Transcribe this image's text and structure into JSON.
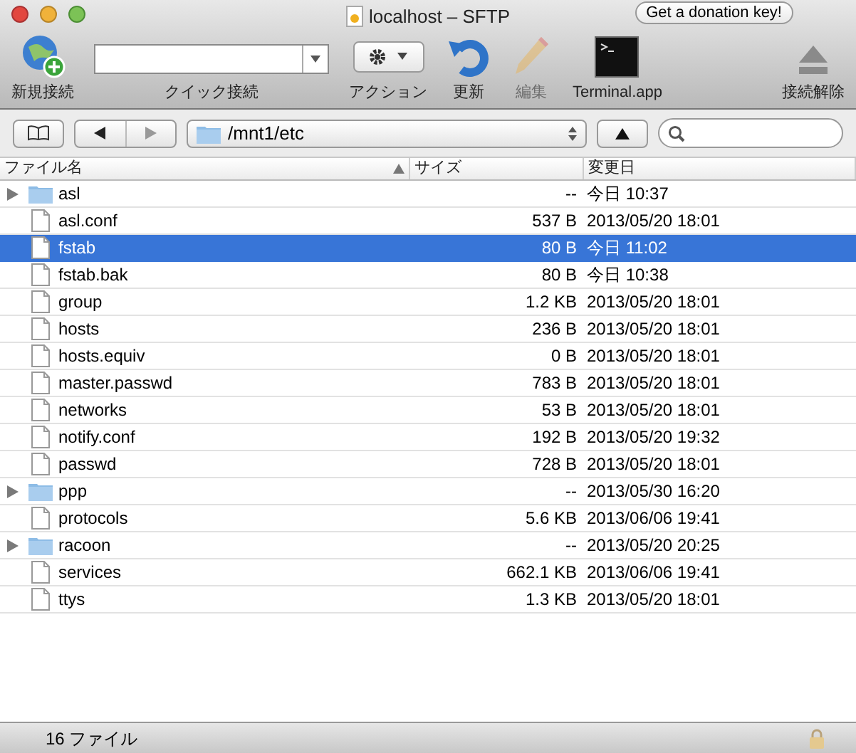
{
  "window": {
    "title": "localhost – SFTP",
    "donation_button": "Get a donation key!"
  },
  "toolbar": [
    {
      "kind": "new",
      "label": "新規接続",
      "disabled": false
    },
    {
      "kind": "quick",
      "label": "クイック接続",
      "disabled": false
    },
    {
      "kind": "action",
      "label": "アクション",
      "disabled": false
    },
    {
      "kind": "refresh",
      "label": "更新",
      "disabled": false
    },
    {
      "kind": "edit",
      "label": "編集",
      "disabled": true
    },
    {
      "kind": "terminal",
      "label": "Terminal.app",
      "disabled": false
    },
    {
      "kind": "disconnect",
      "label": "接続解除",
      "disabled": false
    }
  ],
  "path_bar": {
    "path": "/mnt1/etc"
  },
  "table": {
    "columns": [
      {
        "label": "ファイル名",
        "sorted": true
      },
      {
        "label": "サイズ",
        "sorted": false
      },
      {
        "label": "変更日",
        "sorted": false
      }
    ],
    "rows": [
      {
        "kind": "folder",
        "name": "asl",
        "size": "--",
        "modified": "今日 10:37",
        "selected": false
      },
      {
        "kind": "file",
        "name": "asl.conf",
        "size": "537 B",
        "modified": "2013/05/20 18:01",
        "selected": false
      },
      {
        "kind": "file",
        "name": "fstab",
        "size": "80 B",
        "modified": "今日 11:02",
        "selected": true
      },
      {
        "kind": "file",
        "name": "fstab.bak",
        "size": "80 B",
        "modified": "今日 10:38",
        "selected": false
      },
      {
        "kind": "file",
        "name": "group",
        "size": "1.2 KB",
        "modified": "2013/05/20 18:01",
        "selected": false
      },
      {
        "kind": "file",
        "name": "hosts",
        "size": "236 B",
        "modified": "2013/05/20 18:01",
        "selected": false
      },
      {
        "kind": "file",
        "name": "hosts.equiv",
        "size": "0 B",
        "modified": "2013/05/20 18:01",
        "selected": false
      },
      {
        "kind": "file",
        "name": "master.passwd",
        "size": "783 B",
        "modified": "2013/05/20 18:01",
        "selected": false
      },
      {
        "kind": "file",
        "name": "networks",
        "size": "53 B",
        "modified": "2013/05/20 18:01",
        "selected": false
      },
      {
        "kind": "file",
        "name": "notify.conf",
        "size": "192 B",
        "modified": "2013/05/20 19:32",
        "selected": false
      },
      {
        "kind": "file",
        "name": "passwd",
        "size": "728 B",
        "modified": "2013/05/20 18:01",
        "selected": false
      },
      {
        "kind": "folder",
        "name": "ppp",
        "size": "--",
        "modified": "2013/05/30 16:20",
        "selected": false
      },
      {
        "kind": "file",
        "name": "protocols",
        "size": "5.6 KB",
        "modified": "2013/06/06 19:41",
        "selected": false
      },
      {
        "kind": "folder",
        "name": "racoon",
        "size": "--",
        "modified": "2013/05/20 20:25",
        "selected": false
      },
      {
        "kind": "file",
        "name": "services",
        "size": "662.1 KB",
        "modified": "2013/06/06 19:41",
        "selected": false
      },
      {
        "kind": "file",
        "name": "ttys",
        "size": "1.3 KB",
        "modified": "2013/05/20 18:01",
        "selected": false
      }
    ]
  },
  "status_bar": {
    "text": "16 ファイル",
    "locked": true
  }
}
